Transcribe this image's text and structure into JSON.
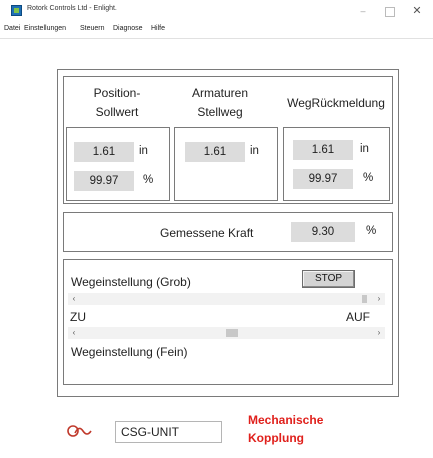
{
  "window": {
    "title": "Rotork Controls Ltd - Enlight.",
    "minimize": "–",
    "close": "✕"
  },
  "menu": [
    "Datei",
    "Einstellungen",
    "Steuern",
    "Diagnose",
    "Hilfe"
  ],
  "position_sollwert": {
    "heading_1": "Position-",
    "heading_2": "Sollwert",
    "value_in": "1.61",
    "unit_in": "in",
    "value_pct": "99.97",
    "unit_pct": "%"
  },
  "armaturen_stellweg": {
    "heading_1": "Armaturen",
    "heading_2": "Stellweg",
    "value_in": "1.61",
    "unit_in": "in"
  },
  "weg_rueckmeldung": {
    "heading": "WegRückmeldung",
    "value_in": "1.61",
    "unit_in": "in",
    "value_pct": "99.97",
    "unit_pct": "%"
  },
  "kraft": {
    "label": "Gemessene Kraft",
    "value": "9.30",
    "unit": "%"
  },
  "wegeinstellung": {
    "grob_label": "Wegeinstellung (Grob)",
    "stop_label": "STOP",
    "zu_label": "ZU",
    "auf_label": "AUF",
    "fein_label": "Wegeinstellung (Fein)",
    "grob_position": 0.98,
    "fein_position": 0.52,
    "arrow_left": "‹",
    "arrow_right": "›"
  },
  "status": {
    "unit_value": "CSG-UNIT",
    "warning_1": "Mechanische",
    "warning_2": "Kopplung"
  },
  "colors": {
    "warning": "#e0201c",
    "field_bg": "#dcdcdc",
    "icon": "#c0392b"
  }
}
